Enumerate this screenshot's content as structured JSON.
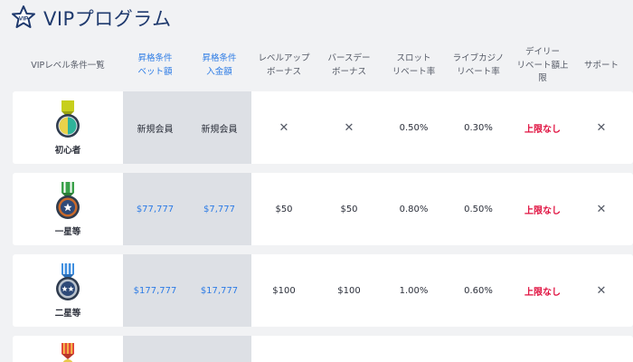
{
  "header": {
    "title": "VIPプログラム",
    "badge_text": "VIP"
  },
  "columns": [
    {
      "label": "VIPレベル条件一覧"
    },
    {
      "label_line1": "昇格条件",
      "label_line2": "ベット額"
    },
    {
      "label_line1": "昇格条件",
      "label_line2": "入金額"
    },
    {
      "label_line1": "レベルアップ",
      "label_line2": "ボーナス"
    },
    {
      "label_line1": "バースデー",
      "label_line2": "ボーナス"
    },
    {
      "label_line1": "スロット",
      "label_line2": "リベート率"
    },
    {
      "label_line1": "ライブカジノ",
      "label_line2": "リベート率"
    },
    {
      "label_line1": "デイリー",
      "label_line2": "リベート額上",
      "label_line3": "限"
    },
    {
      "label": "サポート"
    }
  ],
  "rows": [
    {
      "level": "初心者",
      "medal_icon": "beginner-medal-icon",
      "bet": "新規会員",
      "deposit": "新規会員",
      "levelup_bonus": "✕",
      "birthday_bonus": "✕",
      "slot_rebate": "0.50%",
      "live_rebate": "0.30%",
      "daily_limit": "上限なし",
      "support": "✕"
    },
    {
      "level": "一星等",
      "medal_icon": "one-star-medal-icon",
      "bet": "$77,777",
      "deposit": "$7,777",
      "levelup_bonus": "$50",
      "birthday_bonus": "$50",
      "slot_rebate": "0.80%",
      "live_rebate": "0.50%",
      "daily_limit": "上限なし",
      "support": "✕"
    },
    {
      "level": "二星等",
      "medal_icon": "two-star-medal-icon",
      "bet": "$177,777",
      "deposit": "$17,777",
      "levelup_bonus": "$100",
      "birthday_bonus": "$100",
      "slot_rebate": "1.00%",
      "live_rebate": "0.60%",
      "daily_limit": "上限なし",
      "support": "✕"
    }
  ],
  "colors": {
    "accent_blue": "#2c7be5",
    "highlight_red": "#e0103f",
    "title_navy": "#1f3a6e",
    "requirement_bg": "#dde0e5",
    "page_bg": "#f1f2f4"
  }
}
